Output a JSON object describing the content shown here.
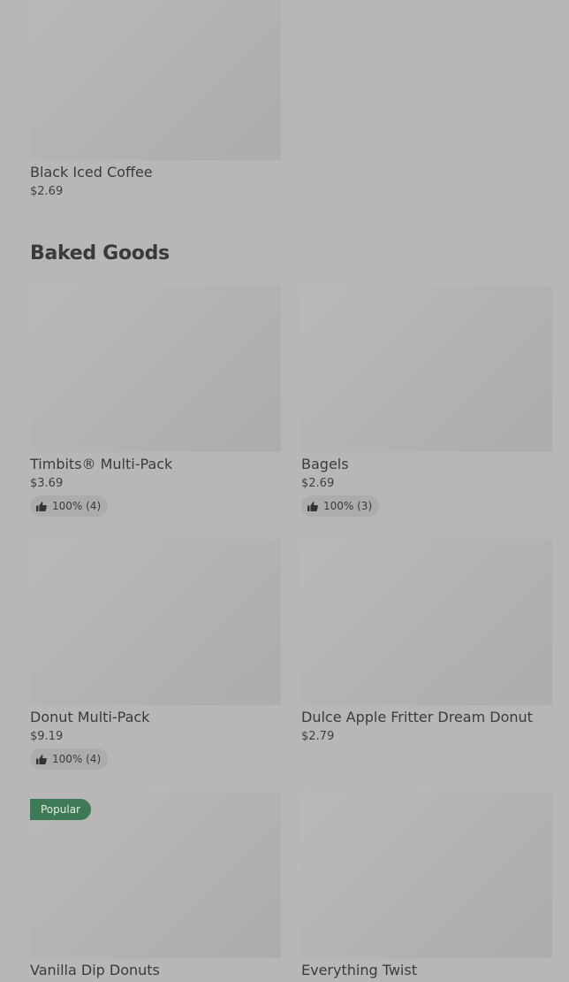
{
  "sections": {
    "baked_goods_heading": "Baked Goods"
  },
  "items": {
    "black_iced_coffee": {
      "title": "Black Iced Coffee",
      "price": "$2.69"
    },
    "timbits": {
      "title": "Timbits® Multi-Pack",
      "price": "$3.69",
      "rating": "100% (4)"
    },
    "bagels": {
      "title": "Bagels",
      "price": "$2.69",
      "rating": "100% (3)"
    },
    "donut_multi_pack": {
      "title": "Donut Multi-Pack",
      "price": "$9.19",
      "rating": "100% (4)"
    },
    "dulce_apple_fritter": {
      "title": "Dulce Apple Fritter Dream Donut",
      "price": "$2.79"
    },
    "vanilla_dip_donuts": {
      "title": "Vanilla Dip Donuts",
      "badge": "Popular"
    },
    "everything_twist": {
      "title": "Everything Twist"
    }
  },
  "icons": {
    "rating": "thumbs-up-icon"
  },
  "colors": {
    "popular_badge": "#3f7a57"
  }
}
